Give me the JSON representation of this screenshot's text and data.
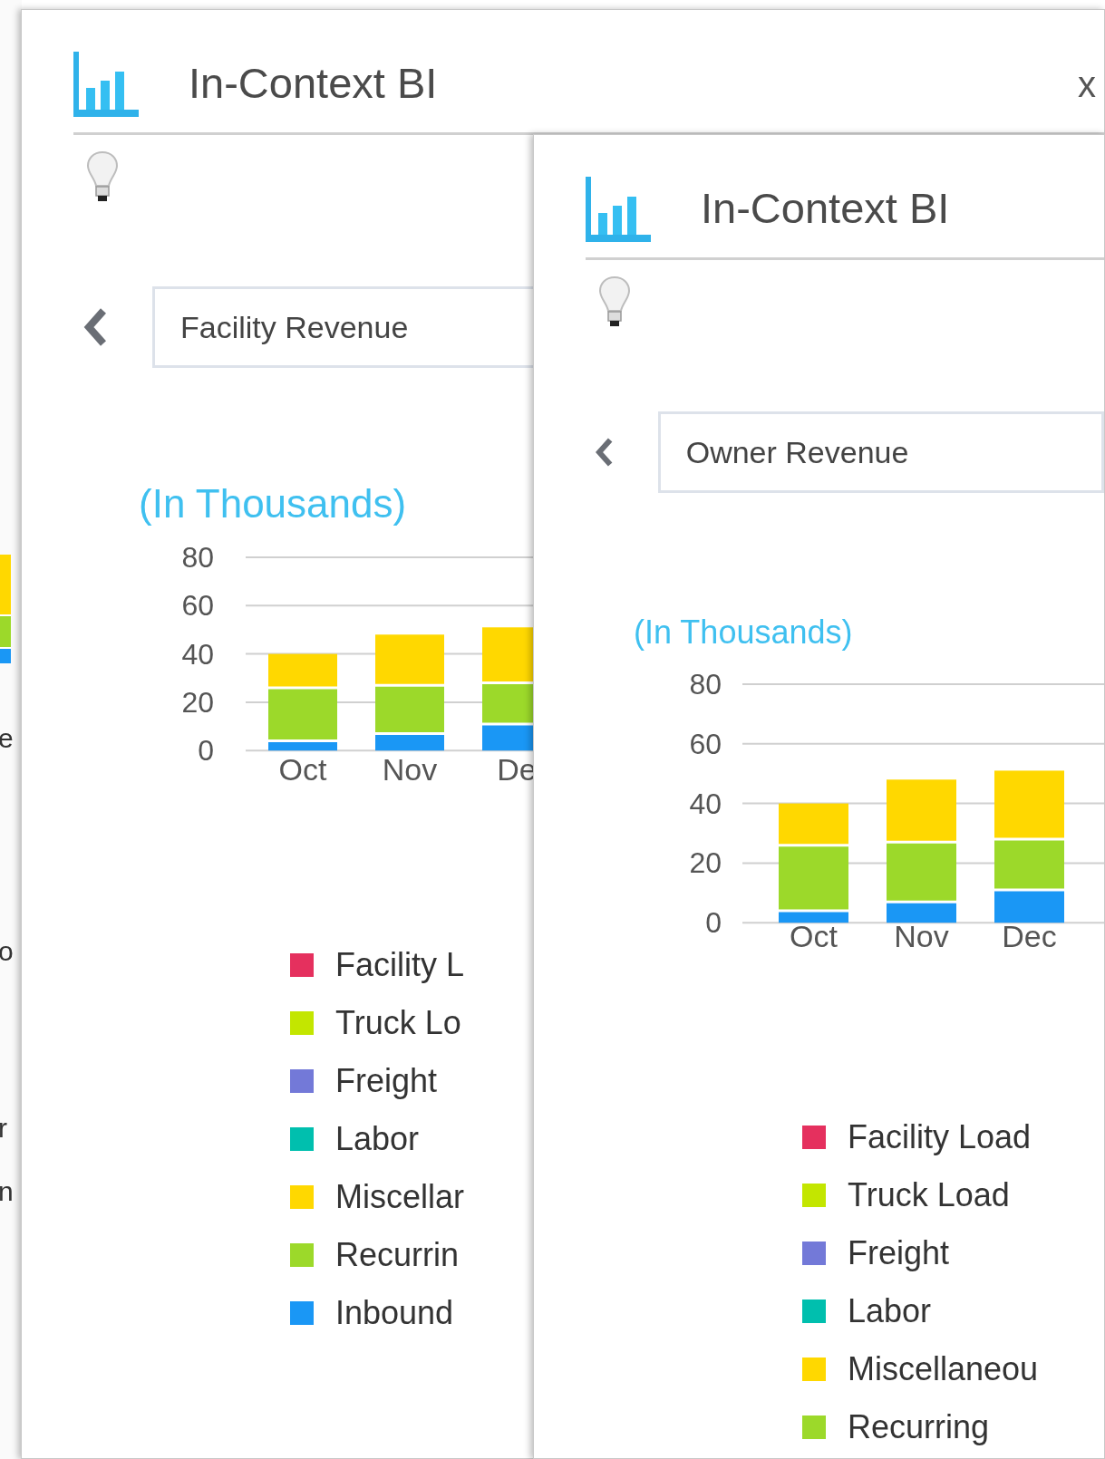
{
  "background": {
    "fragments": [
      "e",
      "o",
      "r",
      "n"
    ]
  },
  "panels": [
    {
      "title": "In-Context BI",
      "close": "x",
      "report": "Facility Revenue",
      "unit_note": "(In Thousands)",
      "chart_data": {
        "type": "bar",
        "stacked": true,
        "grid": true,
        "categories": [
          "Oct",
          "Nov",
          "De"
        ],
        "ylim": [
          0,
          80
        ],
        "yticks": [
          0,
          20,
          40,
          60,
          80
        ],
        "series": [
          {
            "color": "#1a97f5",
            "values": [
              4,
              7,
              11
            ]
          },
          {
            "color": "#9cd92a",
            "values": [
              22,
              20,
              17
            ]
          },
          {
            "color": "#ffd800",
            "values": [
              14,
              21,
              23
            ]
          }
        ]
      },
      "legend": [
        {
          "label": "Facility L",
          "color": "#e5305e"
        },
        {
          "label": "Truck Lo",
          "color": "#c3e600"
        },
        {
          "label": "Freight",
          "color": "#7379d8"
        },
        {
          "label": "Labor",
          "color": "#00bfae"
        },
        {
          "label": "Miscellar",
          "color": "#ffd800"
        },
        {
          "label": "Recurrin",
          "color": "#9cd92a"
        },
        {
          "label": "Inbound",
          "color": "#1a97f5"
        }
      ]
    },
    {
      "title": "In-Context BI",
      "report": "Owner Revenue",
      "unit_note": "(In Thousands)",
      "chart_data": {
        "type": "bar",
        "stacked": true,
        "grid": true,
        "categories": [
          "Oct",
          "Nov",
          "Dec"
        ],
        "ylim": [
          0,
          80
        ],
        "yticks": [
          0,
          20,
          40,
          60,
          80
        ],
        "series": [
          {
            "color": "#1a97f5",
            "values": [
              4,
              7,
              11
            ]
          },
          {
            "color": "#9cd92a",
            "values": [
              22,
              20,
              17
            ]
          },
          {
            "color": "#ffd800",
            "values": [
              14,
              21,
              23
            ]
          }
        ]
      },
      "legend": [
        {
          "label": "Facility Load",
          "color": "#e5305e"
        },
        {
          "label": "Truck Load",
          "color": "#c3e600"
        },
        {
          "label": "Freight",
          "color": "#7379d8"
        },
        {
          "label": "Labor",
          "color": "#00bfae"
        },
        {
          "label": "Miscellaneou",
          "color": "#ffd800"
        },
        {
          "label": "Recurring",
          "color": "#9cd92a"
        }
      ]
    }
  ]
}
